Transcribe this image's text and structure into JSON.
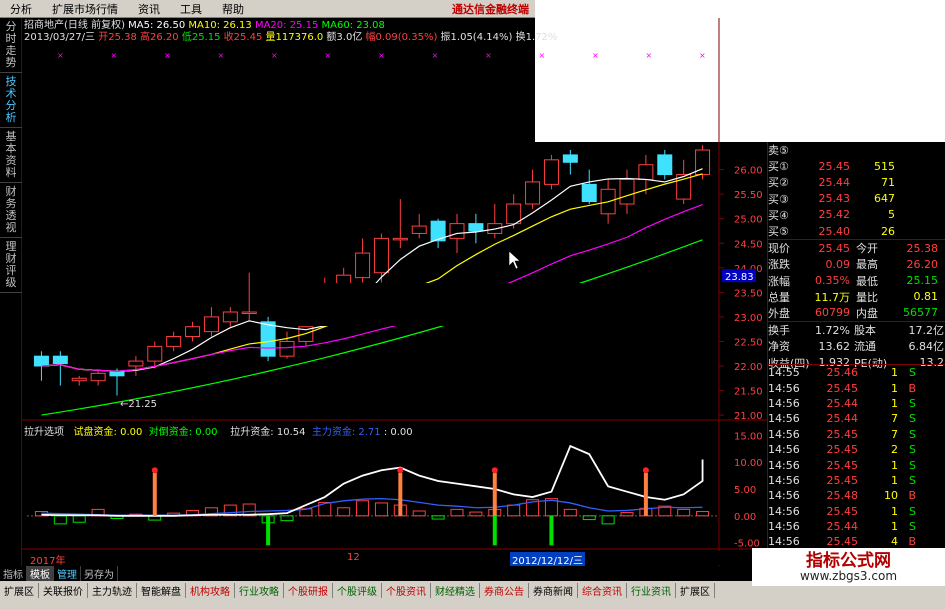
{
  "menu": {
    "items": [
      "分析",
      "扩展市场行情",
      "资讯",
      "工具",
      "帮助"
    ],
    "promo": "通达信金融终端"
  },
  "left_tabs": [
    {
      "label": "分时走势",
      "active": false
    },
    {
      "label": "技术分析",
      "active": true
    },
    {
      "label": "基本资料",
      "active": false
    },
    {
      "label": "财务透视",
      "active": false
    },
    {
      "label": "理财评级",
      "active": false
    }
  ],
  "header": {
    "title": "招商地产(日线 前复权)",
    "ma5": "MA5: 26.50",
    "ma10": "MA10: 26.13",
    "ma20": "MA20: 25.15",
    "ma60": "MA60: 23.08",
    "date": "2013/03/27/三",
    "open": "开25.38",
    "high": "高26.20",
    "low": "低25.15",
    "close": "收25.45",
    "volume": "量117376.0",
    "amount": "额3.0亿",
    "change": "幅0.09(0.35%)",
    "amplitude": "振1.05(4.14%)",
    "turnover": "换1.72%"
  },
  "chart_data": {
    "type": "candlestick",
    "y_ticks": [
      "26.00",
      "25.50",
      "25.00",
      "24.50",
      "24.00",
      "23.50",
      "23.00",
      "22.50",
      "22.00",
      "21.50",
      "21.00"
    ],
    "price_marker": "23.83",
    "low_annotation": "←21.25",
    "candles": [
      {
        "o": 22.2,
        "c": 22.0,
        "h": 22.3,
        "l": 21.7
      },
      {
        "o": 22.2,
        "c": 22.05,
        "h": 22.3,
        "l": 21.6
      },
      {
        "o": 21.7,
        "c": 21.75,
        "h": 21.8,
        "l": 21.6
      },
      {
        "o": 21.7,
        "c": 21.85,
        "h": 21.9,
        "l": 21.6
      },
      {
        "o": 21.9,
        "c": 21.8,
        "h": 21.95,
        "l": 21.4
      },
      {
        "o": 22.0,
        "c": 22.1,
        "h": 22.2,
        "l": 21.8
      },
      {
        "o": 22.1,
        "c": 22.4,
        "h": 22.5,
        "l": 21.95
      },
      {
        "o": 22.4,
        "c": 22.6,
        "h": 22.7,
        "l": 22.3
      },
      {
        "o": 22.6,
        "c": 22.8,
        "h": 22.9,
        "l": 22.5
      },
      {
        "o": 22.7,
        "c": 23.0,
        "h": 23.2,
        "l": 22.6
      },
      {
        "o": 22.9,
        "c": 23.1,
        "h": 23.2,
        "l": 22.8
      },
      {
        "o": 23.1,
        "c": 23.1,
        "h": 23.9,
        "l": 22.9
      },
      {
        "o": 22.9,
        "c": 22.2,
        "h": 23.0,
        "l": 22.1
      },
      {
        "o": 22.2,
        "c": 22.5,
        "h": 22.7,
        "l": 22.15
      },
      {
        "o": 22.5,
        "c": 22.8,
        "h": 22.9,
        "l": 22.4
      },
      {
        "o": 23.0,
        "c": 23.5,
        "h": 23.8,
        "l": 22.9
      },
      {
        "o": 23.3,
        "c": 23.85,
        "h": 24.0,
        "l": 23.2
      },
      {
        "o": 23.8,
        "c": 24.3,
        "h": 24.6,
        "l": 23.7
      },
      {
        "o": 23.9,
        "c": 24.6,
        "h": 24.7,
        "l": 23.7
      },
      {
        "o": 24.6,
        "c": 24.6,
        "h": 25.4,
        "l": 24.4
      },
      {
        "o": 24.7,
        "c": 24.85,
        "h": 25.1,
        "l": 24.6
      },
      {
        "o": 24.95,
        "c": 24.55,
        "h": 25.0,
        "l": 24.4
      },
      {
        "o": 24.6,
        "c": 24.9,
        "h": 25.1,
        "l": 24.3
      },
      {
        "o": 24.9,
        "c": 24.75,
        "h": 25.1,
        "l": 24.5
      },
      {
        "o": 24.7,
        "c": 24.9,
        "h": 25.3,
        "l": 24.6
      },
      {
        "o": 24.9,
        "c": 25.3,
        "h": 25.5,
        "l": 24.8
      },
      {
        "o": 25.3,
        "c": 25.75,
        "h": 26.0,
        "l": 25.2
      },
      {
        "o": 25.7,
        "c": 26.2,
        "h": 26.3,
        "l": 25.6
      },
      {
        "o": 26.3,
        "c": 26.15,
        "h": 26.4,
        "l": 25.9
      },
      {
        "o": 25.7,
        "c": 25.35,
        "h": 26.0,
        "l": 25.3
      },
      {
        "o": 25.1,
        "c": 25.6,
        "h": 25.8,
        "l": 24.9
      },
      {
        "o": 25.3,
        "c": 25.8,
        "h": 26.0,
        "l": 25.1
      },
      {
        "o": 25.8,
        "c": 26.1,
        "h": 26.3,
        "l": 25.5
      },
      {
        "o": 26.3,
        "c": 25.9,
        "h": 26.4,
        "l": 25.8
      },
      {
        "o": 25.4,
        "c": 25.9,
        "h": 26.2,
        "l": 25.3
      },
      {
        "o": 25.9,
        "c": 26.4,
        "h": 26.5,
        "l": 25.8
      }
    ],
    "ma_lines": [
      {
        "name": "MA5",
        "color": "#ffffff"
      },
      {
        "name": "MA10",
        "color": "#ffff00"
      },
      {
        "name": "MA20",
        "color": "#ff00ff"
      },
      {
        "name": "MA60",
        "color": "#00ff00"
      }
    ],
    "sub_indicator": {
      "title": "拉升选项",
      "trial": "试盘资金: 0.00",
      "hedge": "对倒资金: 0.00",
      "lift": "拉升资金: 10.54",
      "main": "主力资金: 2.71",
      "last": ": 0.00",
      "y_ticks": [
        "15.00",
        "10.00",
        "5.00",
        "0.00",
        "-5.00"
      ]
    },
    "date_labels": [
      "2017年",
      "12",
      "2012/12/12/三"
    ]
  },
  "quote": {
    "asks_bids": [
      {
        "label": "卖⑤",
        "price": "",
        "vol": ""
      },
      {
        "label": "买①",
        "price": "25.45",
        "vol": "515"
      },
      {
        "label": "买②",
        "price": "25.44",
        "vol": "71"
      },
      {
        "label": "买③",
        "price": "25.43",
        "vol": "647"
      },
      {
        "label": "买④",
        "price": "25.42",
        "vol": "5"
      },
      {
        "label": "买⑤",
        "price": "25.40",
        "vol": "26"
      }
    ],
    "stats": [
      {
        "l1": "现价",
        "v1": "25.45",
        "l2": "今开",
        "v2": "25.38"
      },
      {
        "l1": "涨跌",
        "v1": "0.09",
        "l2": "最高",
        "v2": "26.20"
      },
      {
        "l1": "涨幅",
        "v1": "0.35%",
        "l2": "最低",
        "v2": "25.15"
      },
      {
        "l1": "总量",
        "v1": "11.7万",
        "l2": "量比",
        "v2": "0.81"
      },
      {
        "l1": "外盘",
        "v1": "60799",
        "l2": "内盘",
        "v2": "56577"
      }
    ],
    "fin": [
      {
        "l1": "换手",
        "v1": "1.72%",
        "l2": "股本",
        "v2": "17.2亿"
      },
      {
        "l1": "净资",
        "v1": "13.62",
        "l2": "流通",
        "v2": "6.84亿"
      },
      {
        "l1": "收益(四)",
        "v1": "1.932",
        "l2": "PE(动)",
        "v2": "13.2"
      }
    ]
  },
  "ticks": [
    {
      "time": "14:55",
      "price": "25.46",
      "vol": "1",
      "bs": "S"
    },
    {
      "time": "14:56",
      "price": "25.45",
      "vol": "1",
      "bs": "B"
    },
    {
      "time": "14:56",
      "price": "25.44",
      "vol": "1",
      "bs": "S"
    },
    {
      "time": "14:56",
      "price": "25.44",
      "vol": "7",
      "bs": "S"
    },
    {
      "time": "14:56",
      "price": "25.45",
      "vol": "7",
      "bs": "S"
    },
    {
      "time": "14:56",
      "price": "25.45",
      "vol": "2",
      "bs": "S"
    },
    {
      "time": "14:56",
      "price": "25.45",
      "vol": "1",
      "bs": "S"
    },
    {
      "time": "14:56",
      "price": "25.45",
      "vol": "1",
      "bs": "S"
    },
    {
      "time": "14:56",
      "price": "25.48",
      "vol": "10",
      "bs": "B"
    },
    {
      "time": "14:56",
      "price": "25.45",
      "vol": "1",
      "bs": "S"
    },
    {
      "time": "14:56",
      "price": "25.44",
      "vol": "1",
      "bs": "S"
    },
    {
      "time": "14:56",
      "price": "25.45",
      "vol": "4",
      "bs": "B"
    }
  ],
  "bottom_tabs": [
    "指标",
    "模板",
    "管理",
    "另存为"
  ],
  "nav": [
    {
      "label": "扩展区",
      "c": "cl1"
    },
    {
      "label": "关联报价",
      "c": "cl1"
    },
    {
      "label": "主力轨迹",
      "c": "cl1"
    },
    {
      "label": "智能解盘",
      "c": "cl1"
    },
    {
      "label": "机构攻略",
      "c": "cl2"
    },
    {
      "label": "行业攻略",
      "c": "cl3"
    },
    {
      "label": "个股研报",
      "c": "cl2"
    },
    {
      "label": "个股评级",
      "c": "cl3"
    },
    {
      "label": "个股资讯",
      "c": "cl2"
    },
    {
      "label": "财经精选",
      "c": "cl3"
    },
    {
      "label": "券商公告",
      "c": "cl2"
    },
    {
      "label": "券商新闻",
      "c": "cl1"
    },
    {
      "label": "综合资讯",
      "c": "cl2"
    },
    {
      "label": "行业资讯",
      "c": "cl3"
    },
    {
      "label": "扩展区",
      "c": "cl1"
    }
  ],
  "watermark": {
    "title": "指标公式网",
    "url": "www.zbgs3.com"
  }
}
